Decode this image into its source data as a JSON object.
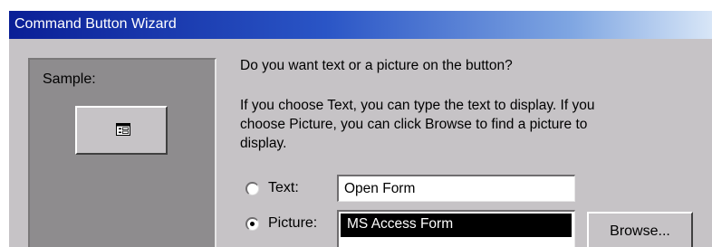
{
  "window": {
    "title": "Command Button Wizard"
  },
  "sample": {
    "label": "Sample:",
    "button_icon": "form-icon"
  },
  "question": "Do you want text or a picture on the button?",
  "instructions": [
    "If you choose Text, you can type the text to display.  If you",
    "choose Picture, you can click Browse to find a picture to",
    "display."
  ],
  "options": {
    "text": {
      "label": "Text:",
      "selected": false,
      "value": "Open Form"
    },
    "picture": {
      "label": "Picture:",
      "selected": true,
      "list_items": [
        "MS Access Form"
      ],
      "selected_item": "MS Access Form"
    }
  },
  "browse_button": {
    "label": "Browse..."
  },
  "colors": {
    "dialog_face": "#c6c3c6",
    "sample_panel": "#8e8c8e",
    "titlebar_start": "#0a1f96",
    "titlebar_end": "#d8e6f7",
    "selection": "#000000"
  }
}
